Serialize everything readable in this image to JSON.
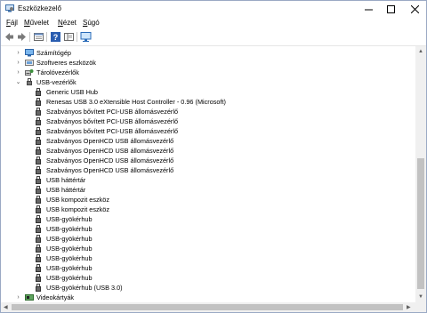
{
  "window": {
    "title": "Eszközkezelő",
    "icon": "device-manager-icon"
  },
  "menu": [
    {
      "label": "Fájl",
      "key": "F"
    },
    {
      "label": "Művelet",
      "key": "M"
    },
    {
      "label": "Nézet",
      "key": "N"
    },
    {
      "label": "Súgó",
      "key": "S"
    }
  ],
  "toolbar": {
    "buttons": [
      "back-icon",
      "forward-icon",
      "properties-icon",
      "help-icon",
      "view-icon",
      "monitor-icon"
    ]
  },
  "tree": {
    "categories_before": [
      {
        "label": "Számítógép",
        "icon": "computer-icon",
        "expanded": false
      },
      {
        "label": "Szoftveres eszközök",
        "icon": "software-device-icon",
        "expanded": false
      },
      {
        "label": "Tárolóvezérlők",
        "icon": "storage-controller-icon",
        "expanded": false
      }
    ],
    "usb_category": {
      "label": "USB-vezérlők",
      "icon": "usb-icon",
      "expanded": true
    },
    "usb_devices": [
      "Generic USB Hub",
      "Renesas USB 3.0 eXtensible Host Controller - 0.96 (Microsoft)",
      "Szabványos bővített PCI-USB állomásvezérlő",
      "Szabványos bővített PCI-USB állomásvezérlő",
      "Szabványos bővített PCI-USB állomásvezérlő",
      "Szabványos OpenHCD USB állomásvezérlő",
      "Szabványos OpenHCD USB állomásvezérlő",
      "Szabványos OpenHCD USB állomásvezérlő",
      "Szabványos OpenHCD USB állomásvezérlő",
      "USB háttértár",
      "USB háttértár",
      "USB kompozit eszköz",
      "USB kompozit eszköz",
      "USB-gyökérhub",
      "USB-gyökérhub",
      "USB-gyökérhub",
      "USB-gyökérhub",
      "USB-gyökérhub",
      "USB-gyökérhub",
      "USB-gyökérhub",
      "USB-gyökérhub (USB 3.0)"
    ],
    "categories_after": [
      {
        "label": "Videokártyák",
        "icon": "display-adapter-icon",
        "expanded": false
      }
    ]
  },
  "colors": {
    "accent": "#1e66c8",
    "scrollbar_thumb": "#c2c2c2"
  }
}
